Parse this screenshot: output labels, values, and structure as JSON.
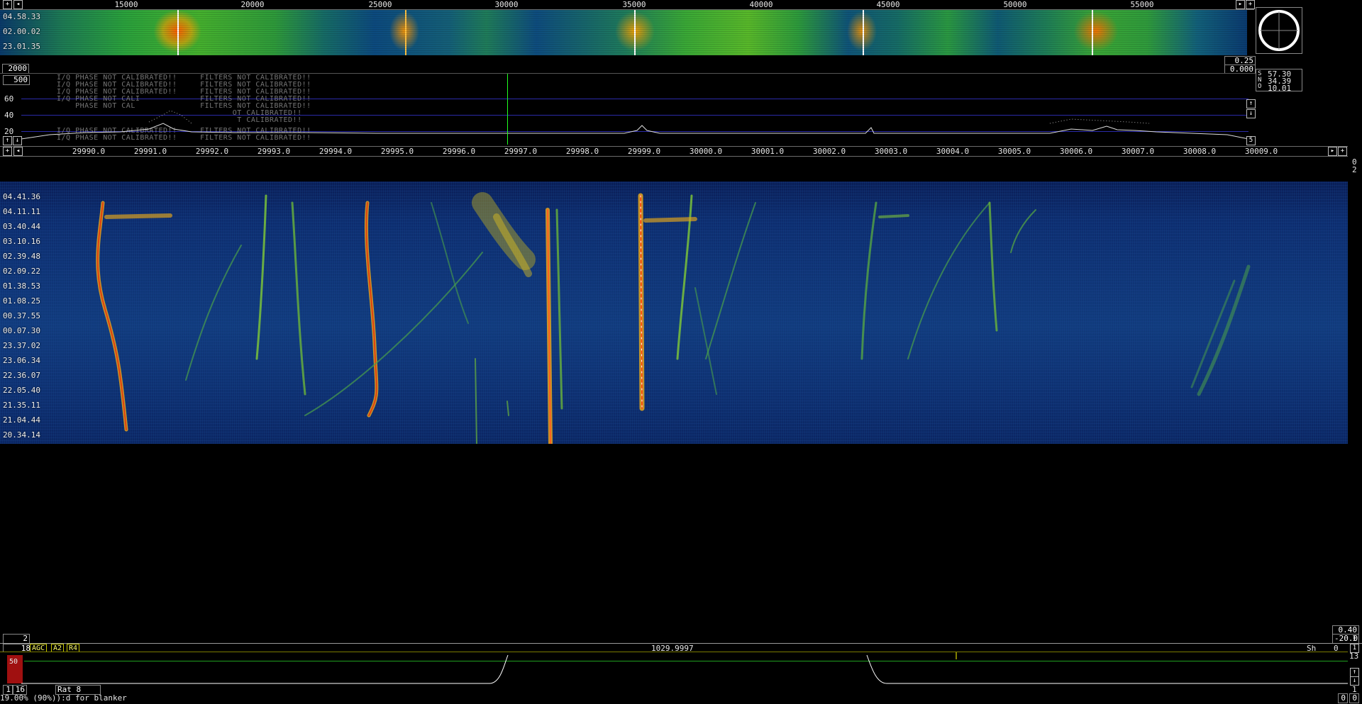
{
  "top_scale": {
    "ticks": [
      "15000",
      "20000",
      "25000",
      "30000",
      "35000",
      "40000",
      "45000",
      "50000",
      "55000"
    ]
  },
  "top_waterfall": {
    "time_labels": [
      "04.58.33",
      "02.00.02",
      "23.01.35"
    ]
  },
  "top_readouts": {
    "left": "2000",
    "right_upper": "0.25",
    "right_lower": "0.000"
  },
  "spectrum": {
    "level_box": "500",
    "y_ticks": [
      "60",
      "40",
      "20"
    ],
    "calibration_lines": [
      "I/Q PHASE NOT CALIBRATED!!     FILTERS NOT CALIBRATED!!",
      "I/Q PHASE NOT CALIBRATED!!     FILTERS NOT CALIBRATED!!",
      "I/Q PHASE NOT CALIBRATED!!     FILTERS NOT CALIBRATED!!",
      "I/Q PHASE NOT CALI             FILTERS NOT CALIBRATED!!",
      "    PHASE NOT CAL              FILTERS NOT CALIBRATED!!",
      "                                      OT CALIBRATED!!",
      "                                       T CALIBRATED!!",
      "I/Q PHASE NOT CALIBRATED!!     FILTERS NOT CALIBRATED!!",
      "I/Q PHASE NOT CALIBRATED!!     FILTERS NOT CALIBRATED!!"
    ],
    "side_values": [
      "57.30",
      "34.39",
      "10.01"
    ],
    "side_letters": [
      "S",
      "N",
      "O"
    ],
    "right_num": "5"
  },
  "main_scale": {
    "ticks": [
      "29990.0",
      "29991.0",
      "29992.0",
      "29993.0",
      "29994.0",
      "29995.0",
      "29996.0",
      "29997.0",
      "29998.0",
      "29999.0",
      "30000.0",
      "30001.0",
      "30002.0",
      "30003.0",
      "30004.0",
      "30005.0",
      "30006.0",
      "30007.0",
      "30008.0",
      "30009.0"
    ],
    "right_values": [
      "0",
      "2"
    ]
  },
  "main_waterfall": {
    "time_labels": [
      "04.41.36",
      "04.11.11",
      "03.40.44",
      "03.10.16",
      "02.39.48",
      "02.09.22",
      "01.38.53",
      "01.08.25",
      "00.37.55",
      "00.07.30",
      "23.37.02",
      "23.06.34",
      "22.36.07",
      "22.05.40",
      "21.35.11",
      "21.04.44",
      "20.34.14"
    ]
  },
  "bottom_readouts": {
    "left_box": "2",
    "right_upper": "0.40",
    "right_lower": "-20.0",
    "right_small": "1"
  },
  "control_bar": {
    "num": "18",
    "agc": "AGC",
    "a2": "A2",
    "r4": "R4",
    "frequency": "1029.9997",
    "sh_label": "Sh",
    "sh_value": "0",
    "right_a": "1",
    "right_b": "13"
  },
  "bfo": {
    "level": "50",
    "btn_1": "1",
    "btn_16": "16",
    "rat": "Rat  8",
    "status": "19.00%  (90%)):d for blanker",
    "bottom_right_a": "0",
    "bottom_right_b": "0",
    "right_num": "1"
  },
  "colors": {
    "background": "#000000",
    "marker_green": "#20ff20",
    "tag_yellow": "#ffff66",
    "level_red": "#a01010"
  }
}
